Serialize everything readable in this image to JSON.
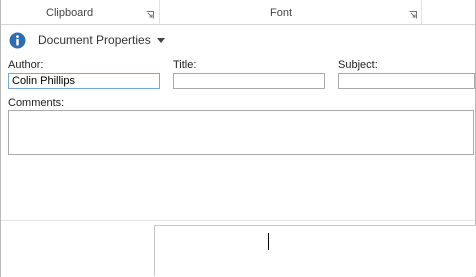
{
  "ribbon": {
    "groups": [
      {
        "label": "Clipboard"
      },
      {
        "label": "Font"
      }
    ]
  },
  "properties_panel": {
    "title": "Document Properties",
    "fields": {
      "author": {
        "label": "Author:",
        "value": "Colin Phillips"
      },
      "title": {
        "label": "Title:",
        "value": ""
      },
      "subject": {
        "label": "Subject:",
        "value": ""
      },
      "comments": {
        "label": "Comments:",
        "value": ""
      }
    }
  },
  "colors": {
    "info_icon": "#2f6db0",
    "active_border": "#7aa7d9"
  }
}
